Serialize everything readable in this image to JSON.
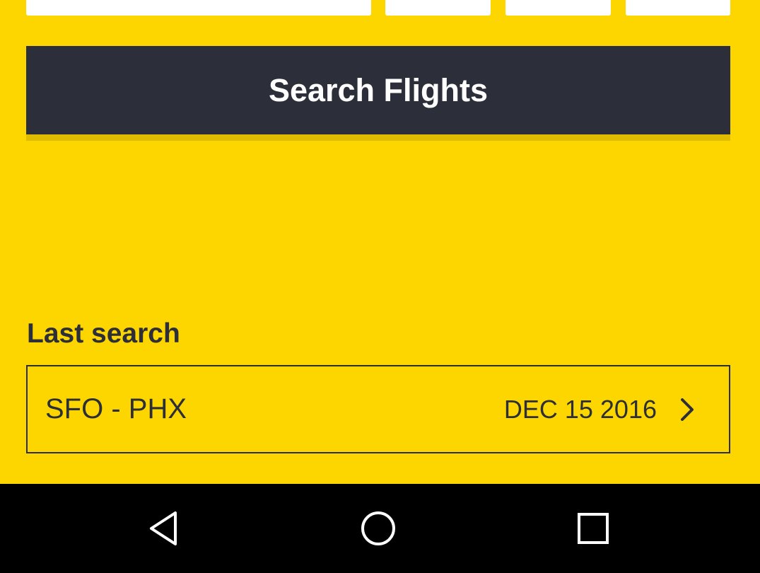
{
  "search": {
    "button_label": "Search Flights"
  },
  "last_search": {
    "heading": "Last search",
    "route": "SFO - PHX",
    "date": "DEC 15 2016",
    "chevron_icon": "chevron-right-icon"
  },
  "navbar": {
    "back_icon": "back-triangle-icon",
    "home_icon": "home-circle-icon",
    "recents_icon": "recents-square-icon"
  },
  "colors": {
    "background": "#FDD600",
    "button": "#2C2F3A",
    "button_shadow": "#E0BC00",
    "text": "#2C2F3A",
    "navbar": "#000000"
  }
}
